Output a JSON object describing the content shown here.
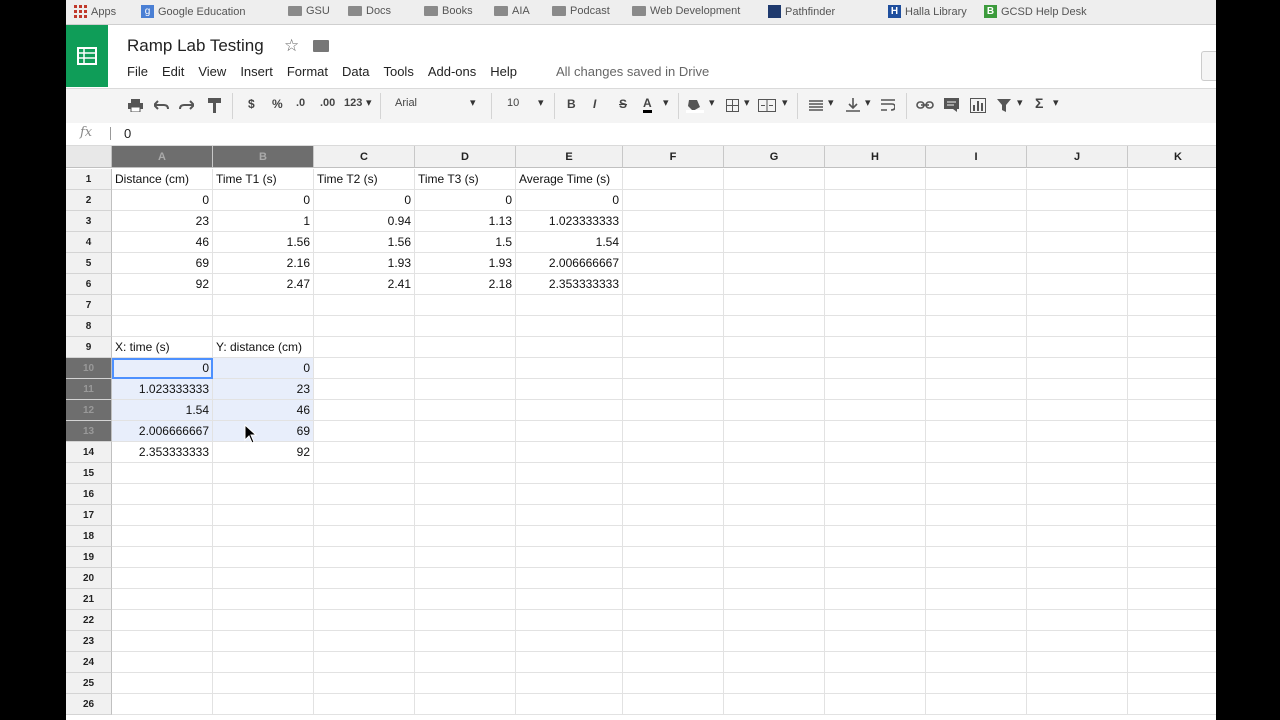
{
  "bookmarks": [
    {
      "label": "Apps",
      "icon": "apps-grid-icon"
    },
    {
      "label": "Google Education",
      "icon": "google-icon"
    },
    {
      "label": "GSU",
      "icon": "folder-icon"
    },
    {
      "label": "Docs",
      "icon": "folder-icon"
    },
    {
      "label": "Books",
      "icon": "folder-icon"
    },
    {
      "label": "AIA",
      "icon": "folder-icon"
    },
    {
      "label": "Podcast",
      "icon": "folder-icon"
    },
    {
      "label": "Web Development",
      "icon": "folder-icon"
    },
    {
      "label": "Pathfinder",
      "icon": "pathfinder-icon"
    },
    {
      "label": "Halla Library",
      "icon": "h-icon"
    },
    {
      "label": "GCSD Help Desk",
      "icon": "b-icon"
    }
  ],
  "document": {
    "title": "Ramp Lab Testing",
    "save_status": "All changes saved in Drive"
  },
  "menu": [
    "File",
    "Edit",
    "View",
    "Insert",
    "Format",
    "Data",
    "Tools",
    "Add-ons",
    "Help"
  ],
  "toolbar": {
    "currency": "$",
    "percent": "%",
    "decrease_decimals": ".0",
    ".00": ".00",
    "more_formats": "123",
    "font": "Arial",
    "font_size": "10",
    "bold": "B",
    "italic": "I",
    "strikethrough": "S",
    "text_color": "A",
    "functions": "Σ"
  },
  "formula_bar": {
    "fx": "fx",
    "value": "0"
  },
  "columns": [
    "A",
    "B",
    "C",
    "D",
    "E",
    "F",
    "G",
    "H",
    "I",
    "J",
    "K"
  ],
  "rows": [
    "1",
    "2",
    "3",
    "4",
    "5",
    "6",
    "7",
    "8",
    "9",
    "10",
    "11",
    "12",
    "13",
    "14",
    "15",
    "16",
    "17",
    "18",
    "19",
    "20",
    "21",
    "22",
    "23",
    "24",
    "25",
    "26"
  ],
  "cells": {
    "r1": [
      "Distance (cm)",
      "Time T1 (s)",
      "Time T2 (s)",
      "Time T3 (s)",
      "Average Time (s)"
    ],
    "r2": [
      "0",
      "0",
      "0",
      "0",
      "0"
    ],
    "r3": [
      "23",
      "1",
      "0.94",
      "1.13",
      "1.023333333"
    ],
    "r4": [
      "46",
      "1.56",
      "1.56",
      "1.5",
      "1.54"
    ],
    "r5": [
      "69",
      "2.16",
      "1.93",
      "1.93",
      "2.006666667"
    ],
    "r6": [
      "92",
      "2.47",
      "2.41",
      "2.18",
      "2.353333333"
    ],
    "r9": [
      "X: time (s)",
      "Y: distance (cm)"
    ],
    "r10": [
      "0",
      "0"
    ],
    "r11": [
      "1.023333333",
      "23"
    ],
    "r12": [
      "1.54",
      "46"
    ],
    "r13": [
      "2.006666667",
      "69"
    ],
    "r14": [
      "2.353333333",
      "92"
    ]
  },
  "colors": {
    "sheets_green": "#0f9d58",
    "selection_blue": "#4d90fe",
    "selection_fill": "#e8eefb"
  }
}
